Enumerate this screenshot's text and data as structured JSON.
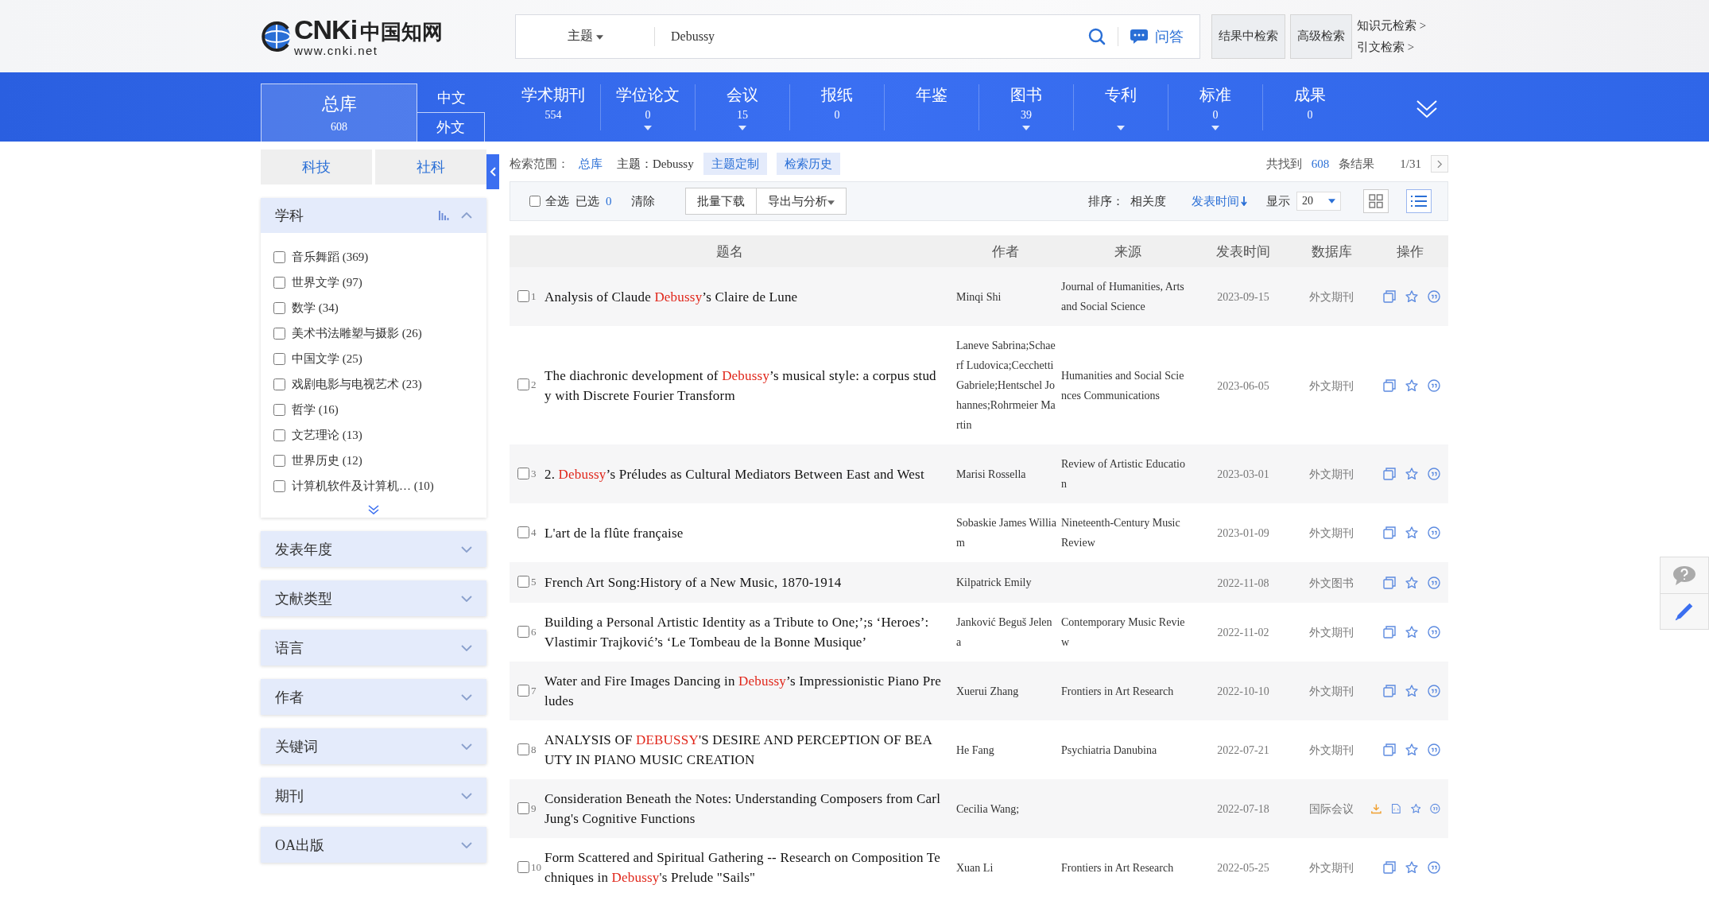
{
  "header": {
    "logo": {
      "mark": "CNKi",
      "name": "中国知网",
      "url": "www.cnki.net"
    },
    "search": {
      "field_type": "主题",
      "value": "Debussy",
      "qa": "问答"
    },
    "buttons": [
      "结果中检索",
      "高级检索"
    ],
    "links": [
      "知识元检索 >",
      "引文检索 >"
    ]
  },
  "nav": {
    "all": {
      "label": "总库",
      "count": "608"
    },
    "langs": [
      {
        "label": "中文",
        "selected": false
      },
      {
        "label": "外文",
        "selected": true
      }
    ],
    "categories": [
      {
        "name": "学术期刊",
        "count": "554",
        "expandable": false
      },
      {
        "name": "学位论文",
        "count": "0",
        "expandable": true
      },
      {
        "name": "会议",
        "count": "15",
        "expandable": true
      },
      {
        "name": "报纸",
        "count": "0",
        "expandable": false
      },
      {
        "name": "年鉴",
        "expandable": false
      },
      {
        "name": "图书",
        "count": "39",
        "expandable": true
      },
      {
        "name": "专利",
        "expandable": true
      },
      {
        "name": "标准",
        "count": "0",
        "expandable": true
      },
      {
        "name": "成果",
        "count": "0",
        "expandable": false
      }
    ]
  },
  "sidebar": {
    "tabs": [
      "科技",
      "社科"
    ],
    "facets": [
      {
        "label": "学科",
        "expanded": true,
        "items": [
          {
            "label": "音乐舞蹈 (369)",
            "checked": false
          },
          {
            "label": "世界文学 (97)",
            "checked": false
          },
          {
            "label": "数学 (34)",
            "checked": false
          },
          {
            "label": "美术书法雕塑与摄影 (26)",
            "checked": false
          },
          {
            "label": "中国文学 (25)",
            "checked": false
          },
          {
            "label": "戏剧电影与电视艺术 (23)",
            "checked": false
          },
          {
            "label": "哲学 (16)",
            "checked": false
          },
          {
            "label": "文艺理论 (13)",
            "checked": false
          },
          {
            "label": "世界历史 (12)",
            "checked": false
          },
          {
            "label": "计算机软件及计算机…  (10)",
            "checked": false
          }
        ]
      },
      {
        "label": "发表年度",
        "expanded": false
      },
      {
        "label": "文献类型",
        "expanded": false
      },
      {
        "label": "语言",
        "expanded": false
      },
      {
        "label": "作者",
        "expanded": false
      },
      {
        "label": "关键词",
        "expanded": false
      },
      {
        "label": "期刊",
        "expanded": false
      },
      {
        "label": "OA出版",
        "expanded": false
      }
    ]
  },
  "scope": {
    "label": "检索范围：",
    "value": "总库",
    "topic": "主题：Debussy",
    "buttons": [
      "主题定制",
      "检索历史"
    ],
    "found_prefix": "共找到",
    "found": "608",
    "found_suffix": "条结果",
    "page": "1/31"
  },
  "toolbar": {
    "select_all": {
      "label": "全选",
      "checked": false
    },
    "selected_label": "已选",
    "selected_count": "0",
    "clear": "清除",
    "buttons": [
      "批量下载",
      "导出与分析"
    ],
    "sort_label": "排序：",
    "sort": [
      {
        "label": "相关度",
        "selected": false
      },
      {
        "label": "发表时间",
        "selected": true
      }
    ],
    "show_label": "显示",
    "page_size": "20",
    "views": [
      {
        "kind": "grid",
        "selected": false
      },
      {
        "kind": "list",
        "selected": true
      }
    ]
  },
  "table": {
    "columns": [
      "题名",
      "作者",
      "来源",
      "发表时间",
      "数据库",
      "操作"
    ],
    "rows": [
      {
        "num": "1",
        "checked": false,
        "title": [
          {
            "text": "Analysis of Claude ",
            "highlight": false
          },
          {
            "text": "Debussy",
            "highlight": true
          },
          {
            "text": "’s Claire de Lune",
            "highlight": false
          }
        ],
        "author": "Minqi Shi",
        "source": "Journal of Humanities, Arts and Social Science",
        "date": "2023-09-15",
        "db": "外文期刊",
        "actions": [
          {
            "kind": "copy"
          },
          {
            "kind": "star"
          },
          {
            "kind": "quote"
          }
        ]
      },
      {
        "num": "2",
        "checked": false,
        "title": [
          {
            "text": "The diachronic development of ",
            "highlight": false
          },
          {
            "text": "Debussy",
            "highlight": true
          },
          {
            "text": "’s musical style: a corpus study with Discrete Fourier Transform",
            "highlight": false
          }
        ],
        "author": "Laneve Sabrina;Schaerf Ludovica;Cecchetti Gabriele;Hentschel Johannes;Rohrmeier Martin",
        "source": "Humanities and Social Sciences Communications",
        "date": "2023-06-05",
        "db": "外文期刊",
        "actions": [
          {
            "kind": "copy"
          },
          {
            "kind": "star"
          },
          {
            "kind": "quote"
          }
        ]
      },
      {
        "num": "3",
        "checked": false,
        "title": [
          {
            "text": "2. ",
            "highlight": false
          },
          {
            "text": "Debussy",
            "highlight": true
          },
          {
            "text": "’s Préludes as Cultural Mediators Between East and West",
            "highlight": false
          }
        ],
        "author": "Marisi Rossella",
        "source": "Review of Artistic Education",
        "date": "2023-03-01",
        "db": "外文期刊",
        "actions": [
          {
            "kind": "copy"
          },
          {
            "kind": "star"
          },
          {
            "kind": "quote"
          }
        ]
      },
      {
        "num": "4",
        "checked": false,
        "title": [
          {
            "text": "L'art de la flûte française",
            "highlight": false
          }
        ],
        "author": "Sobaskie James William",
        "source": "Nineteenth-Century Music Review",
        "date": "2023-01-09",
        "db": "外文期刊",
        "actions": [
          {
            "kind": "copy"
          },
          {
            "kind": "star"
          },
          {
            "kind": "quote"
          }
        ]
      },
      {
        "num": "5",
        "checked": false,
        "title": [
          {
            "text": "French Art Song:History of a New Music, 1870-1914",
            "highlight": false
          }
        ],
        "author": "Kilpatrick Emily",
        "date": "2022-11-08",
        "db": "外文图书",
        "actions": [
          {
            "kind": "copy"
          },
          {
            "kind": "star"
          },
          {
            "kind": "quote"
          }
        ]
      },
      {
        "num": "6",
        "checked": false,
        "title": [
          {
            "text": "Building a Personal Artistic Identity as a Tribute to One;’;s ‘Heroes’: Vlastimir Trajković’s ‘Le Tombeau de la Bonne Musique’",
            "highlight": false
          }
        ],
        "author": "Janković Beguš Jelena",
        "source": "Contemporary Music Review",
        "date": "2022-11-02",
        "db": "外文期刊",
        "actions": [
          {
            "kind": "copy"
          },
          {
            "kind": "star"
          },
          {
            "kind": "quote"
          }
        ]
      },
      {
        "num": "7",
        "checked": false,
        "title": [
          {
            "text": "Water and Fire Images Dancing in ",
            "highlight": false
          },
          {
            "text": "Debussy",
            "highlight": true
          },
          {
            "text": "’s Impressionistic Piano Preludes",
            "highlight": false
          }
        ],
        "author": "Xuerui Zhang",
        "source": "Frontiers in Art Research",
        "date": "2022-10-10",
        "db": "外文期刊",
        "actions": [
          {
            "kind": "copy"
          },
          {
            "kind": "star"
          },
          {
            "kind": "quote"
          }
        ]
      },
      {
        "num": "8",
        "checked": false,
        "title": [
          {
            "text": "ANALYSIS OF ",
            "highlight": false
          },
          {
            "text": "DEBUSSY",
            "highlight": true
          },
          {
            "text": "'S DESIRE AND PERCEPTION OF BEAUTY IN PIANO MUSIC CREATION",
            "highlight": false
          }
        ],
        "author": "He Fang",
        "source": "Psychiatria Danubina",
        "date": "2022-07-21",
        "db": "外文期刊",
        "actions": [
          {
            "kind": "copy"
          },
          {
            "kind": "star"
          },
          {
            "kind": "quote"
          }
        ]
      },
      {
        "num": "9",
        "checked": false,
        "title": [
          {
            "text": "Consideration Beneath the Notes: Understanding Composers from Carl Jung's Cognitive Functions",
            "highlight": false
          }
        ],
        "author": "Cecilia Wang;",
        "date": "2022-07-18",
        "db": "国际会议",
        "actions": [
          {
            "kind": "download"
          },
          {
            "kind": "html"
          },
          {
            "kind": "star"
          },
          {
            "kind": "quote"
          }
        ]
      },
      {
        "num": "10",
        "checked": false,
        "title": [
          {
            "text": "Form Scattered and Spiritual Gathering -- Research on Composition Techniques in ",
            "highlight": false
          },
          {
            "text": "Debussy",
            "highlight": true
          },
          {
            "text": "'s Prelude \"Sails\"",
            "highlight": false
          }
        ],
        "author": "Xuan Li",
        "source": "Frontiers in Art Research",
        "date": "2022-05-25",
        "db": "外文期刊",
        "actions": [
          {
            "kind": "copy"
          },
          {
            "kind": "star"
          },
          {
            "kind": "quote"
          }
        ]
      }
    ]
  }
}
